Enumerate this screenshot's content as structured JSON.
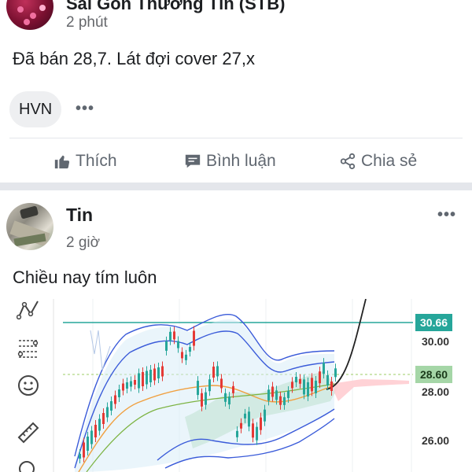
{
  "post1": {
    "author": "Sài Gòn Thương Tín (STB)",
    "time": "2 phút",
    "text": "Đã bán 28,7. Lát đợi cover 27,x",
    "tag": "HVN",
    "more": "•••",
    "actions": {
      "like": "Thích",
      "comment": "Bình luận",
      "share": "Chia sẻ"
    }
  },
  "post2": {
    "author": "Tin",
    "time": "2 giờ",
    "more": "•••",
    "text": "Chiều nay tím luôn"
  },
  "chart_data": {
    "type": "candlestick",
    "price_tags": {
      "top": "30.66",
      "current": "28.60"
    },
    "price_labels": [
      "30.00",
      "28.00",
      "26.00"
    ],
    "colors": {
      "up": "#26a69a",
      "down": "#e53935",
      "bands": "#3a5bd9",
      "cloud_up": "#a5d6a7",
      "cloud_down": "#ffcdd2",
      "tag_top": "#26a69a",
      "tag_current": "#a5d6a7"
    }
  },
  "icons": {
    "like": "thumbs-up-icon",
    "comment": "comment-icon",
    "share": "share-icon"
  }
}
